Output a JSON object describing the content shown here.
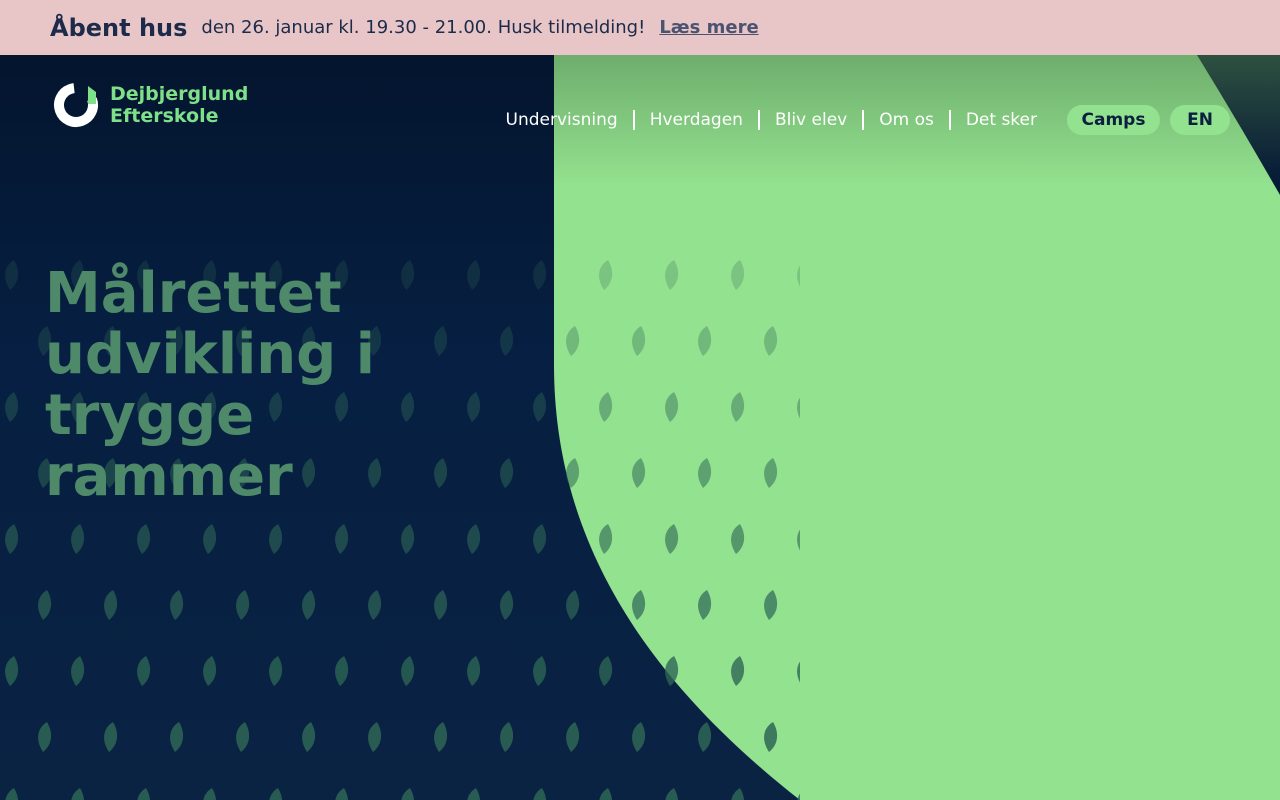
{
  "announcement": {
    "title": "Åbent hus",
    "text": "den 26. januar kl. 19.30 - 21.00. Husk tilmelding!",
    "link": "Læs mere"
  },
  "brand": {
    "line1": "Dejbjerglund",
    "line2": "Efterskole",
    "logo_icon": "logo-mark-icon"
  },
  "nav": {
    "items": [
      "Undervisning",
      "Hverdagen",
      "Bliv elev",
      "Om os",
      "Det sker"
    ],
    "camps": "Camps",
    "lang": "EN"
  },
  "hero": {
    "headline": "Målrettet udvikling i trygge rammer",
    "blurb": ""
  },
  "colors": {
    "announce_bg": "#e8c6c7",
    "navy": "#0a2040",
    "green": "#93e28f",
    "pattern_leaf": "#2e6655"
  }
}
